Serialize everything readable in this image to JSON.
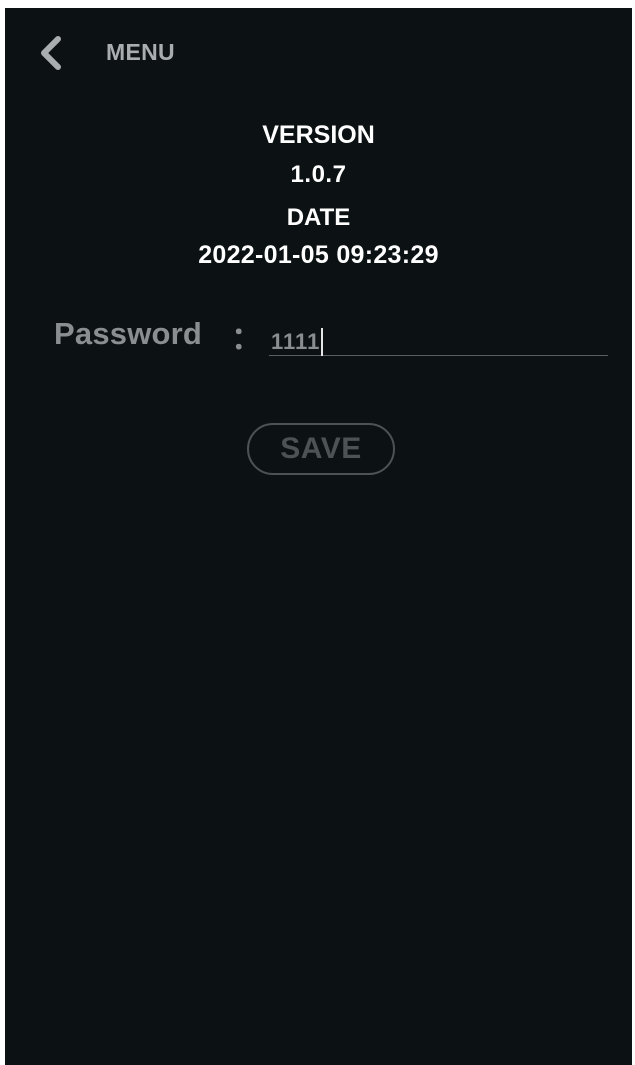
{
  "header": {
    "back_icon": "chevron-left-icon",
    "title": "MENU"
  },
  "info": {
    "version_title": "VERSION",
    "version_value": "1.0.7",
    "date_title": "DATE",
    "date_value": "2022-01-05 09:23:29"
  },
  "password": {
    "label": "Password",
    "colon": "：",
    "value": "1111"
  },
  "save_button": {
    "label": "SAVE"
  },
  "colors": {
    "background": "#0c1214",
    "muted_text": "#8a8e90",
    "disabled_button": "#4d5255"
  }
}
